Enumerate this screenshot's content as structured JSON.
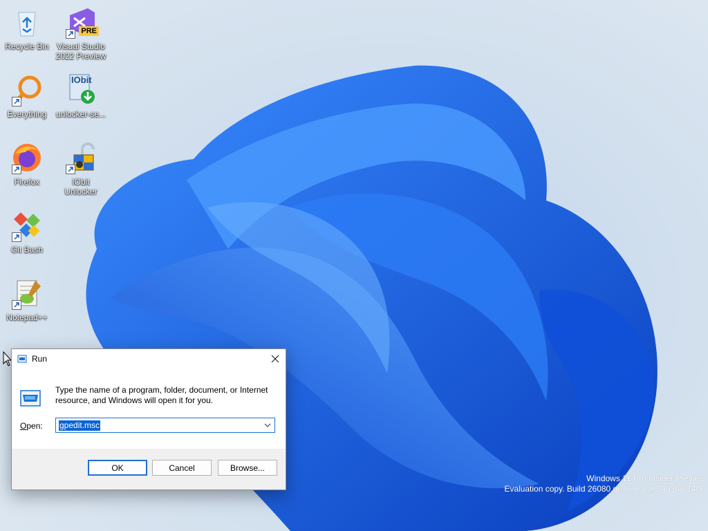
{
  "desktop": {
    "icons": [
      {
        "label": "Recycle Bin",
        "icon": "recycle-bin-icon"
      },
      {
        "label": "Visual Studio 2022 Preview",
        "icon": "visual-studio-icon",
        "badge": "PRE"
      },
      {
        "label": "Everything",
        "icon": "everything-search-icon"
      },
      {
        "label": "unlocker-se...",
        "icon": "iobit-installer-icon",
        "brand": "IObit"
      },
      {
        "label": "Firefox",
        "icon": "firefox-icon"
      },
      {
        "label": "IObit Unlocker",
        "icon": "padlock-icon"
      },
      {
        "label": "Git Bash",
        "icon": "git-bash-icon"
      },
      {
        "label": "Notepad++",
        "icon": "notepad-plus-plus-icon"
      }
    ]
  },
  "run_dialog": {
    "title": "Run",
    "instructions": "Type the name of a program, folder, document, or Internet resource, and Windows will open it for you.",
    "open_label_rest": "pen:",
    "open_label_underline": "O",
    "open_value": "gpedit.msc",
    "ok_label": "OK",
    "cancel_label": "Cancel",
    "browse_label": "Browse..."
  },
  "watermark": {
    "line1": "Windows 11 Pro Insider Preview",
    "line2": "Evaluation copy. Build 26080.ge_release.240308-1400"
  },
  "colors": {
    "accent": "#1a73d1",
    "wallpaper_blue": "#1565e8",
    "selection": "#0a64d6"
  }
}
